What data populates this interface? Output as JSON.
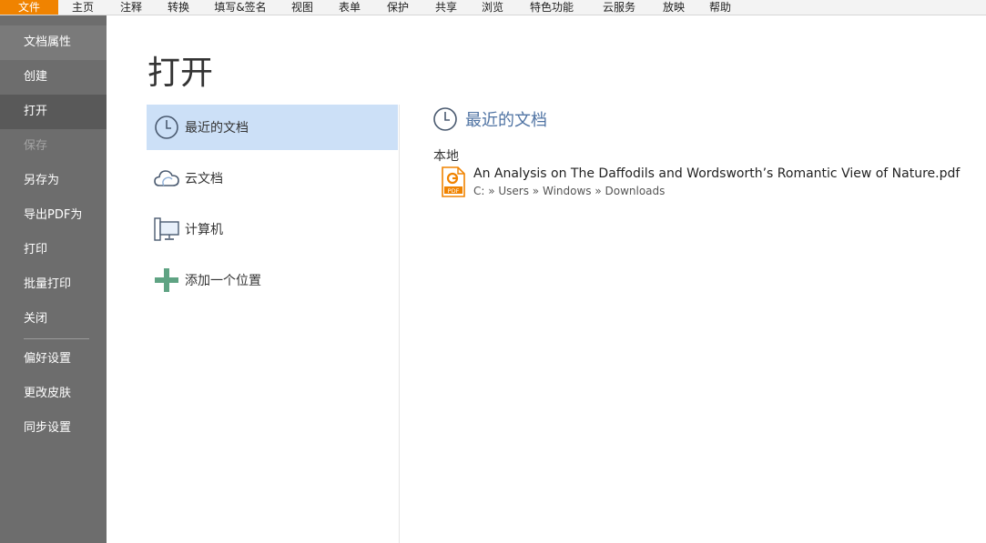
{
  "menubar": {
    "items": [
      {
        "label": "文件",
        "active": true
      },
      {
        "label": "主页"
      },
      {
        "label": "注释"
      },
      {
        "label": "转换"
      },
      {
        "label": "填写&签名"
      },
      {
        "label": "视图"
      },
      {
        "label": "表单"
      },
      {
        "label": "保护"
      },
      {
        "label": "共享"
      },
      {
        "label": "浏览"
      },
      {
        "label": "特色功能"
      },
      {
        "label": "云服务"
      },
      {
        "label": "放映"
      },
      {
        "label": "帮助"
      }
    ]
  },
  "sidebar": {
    "items": [
      {
        "label": "文档属性"
      },
      {
        "label": "创建"
      },
      {
        "label": "打开"
      },
      {
        "label": "保存"
      },
      {
        "label": "另存为"
      },
      {
        "label": "导出PDF为"
      },
      {
        "label": "打印"
      },
      {
        "label": "批量打印"
      },
      {
        "label": "关闭"
      },
      {
        "label": "偏好设置"
      },
      {
        "label": "更改皮肤"
      },
      {
        "label": "同步设置"
      }
    ]
  },
  "main": {
    "title": "打开",
    "places": [
      {
        "label": "最近的文档",
        "icon": "clock-icon"
      },
      {
        "label": "云文档",
        "icon": "cloud-icon"
      },
      {
        "label": "计算机",
        "icon": "computer-icon"
      },
      {
        "label": "添加一个位置",
        "icon": "plus-icon"
      }
    ],
    "recent": {
      "title": "最近的文档",
      "section": "本地",
      "files": [
        {
          "name": "An Analysis on The Daffodils and Wordsworth’s Romantic View of Nature.pdf",
          "path": "C: » Users » Windows » Downloads",
          "icon": "pdf-file-icon"
        }
      ]
    }
  },
  "colors": {
    "accent": "#f08300",
    "sidebar_bg": "#6d6d6d",
    "selected_place": "#cce0f7",
    "recent_title": "#4f73a3"
  }
}
